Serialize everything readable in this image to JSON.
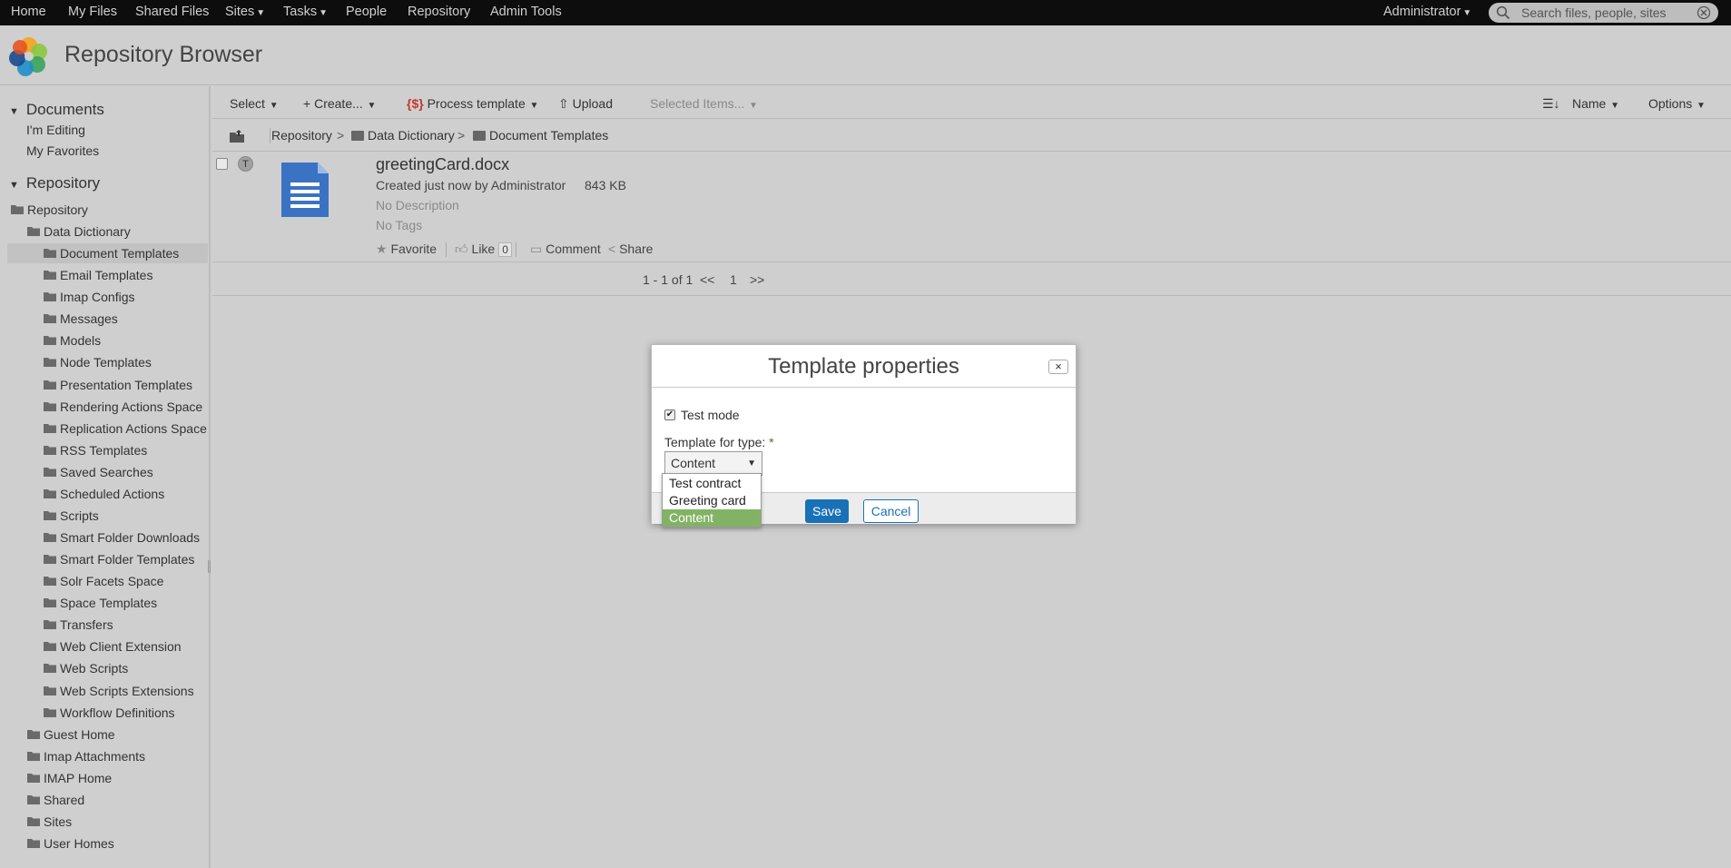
{
  "topnav": {
    "items": [
      "Home",
      "My Files",
      "Shared Files",
      "Sites",
      "Tasks",
      "People",
      "Repository",
      "Admin Tools"
    ],
    "user": "Administrator",
    "search_placeholder": "Search files, people, sites"
  },
  "header": {
    "title": "Repository Browser"
  },
  "sidebar": {
    "documents_heading": "Documents",
    "documents_links": [
      "I'm Editing",
      "My Favorites"
    ],
    "repository_heading": "Repository",
    "tree": [
      "Repository",
      "Data Dictionary",
      "Document Templates",
      "Email Templates",
      "Imap Configs",
      "Messages",
      "Models",
      "Node Templates",
      "Presentation Templates",
      "Rendering Actions Space",
      "Replication Actions Space",
      "RSS Templates",
      "Saved Searches",
      "Scheduled Actions",
      "Scripts",
      "Smart Folder Downloads",
      "Smart Folder Templates",
      "Solr Facets Space",
      "Space Templates",
      "Transfers",
      "Web Client Extension",
      "Web Scripts",
      "Web Scripts Extensions",
      "Workflow Definitions",
      "Guest Home",
      "Imap Attachments",
      "IMAP Home",
      "Shared",
      "Sites",
      "User Homes"
    ]
  },
  "toolbar": {
    "select": "Select",
    "create": "Create...",
    "process_template": "Process template",
    "upload": "Upload",
    "selected_items": "Selected Items...",
    "sort": "Name",
    "options": "Options"
  },
  "breadcrumb": [
    "Repository",
    "Data Dictionary",
    "Document Templates"
  ],
  "document": {
    "badge": "T",
    "name": "greetingCard.docx",
    "meta": "Created just now by Administrator",
    "size": "843 KB",
    "description": "No Description",
    "tags": "No Tags",
    "actions": {
      "favorite": "Favorite",
      "like": "Like",
      "like_count": "0",
      "comment": "Comment",
      "share": "Share"
    }
  },
  "pager": {
    "summary": "1 - 1 of 1",
    "prev": "<<",
    "page": "1",
    "next": ">>"
  },
  "dialog": {
    "title": "Template properties",
    "close": "×",
    "test_mode_label": "Test mode",
    "test_mode_checked": true,
    "type_label": "Template for type:",
    "required_marker": "*",
    "selected_type": "Content",
    "options": [
      "Test contract",
      "Greeting card",
      "Content"
    ],
    "highlighted_option": "Content",
    "save": "Save",
    "cancel": "Cancel"
  },
  "colors": {
    "topbar": "#0d0d0d",
    "primary_button": "#1971b8",
    "highlight": "#82b365",
    "document_icon": "#3b73c4"
  }
}
